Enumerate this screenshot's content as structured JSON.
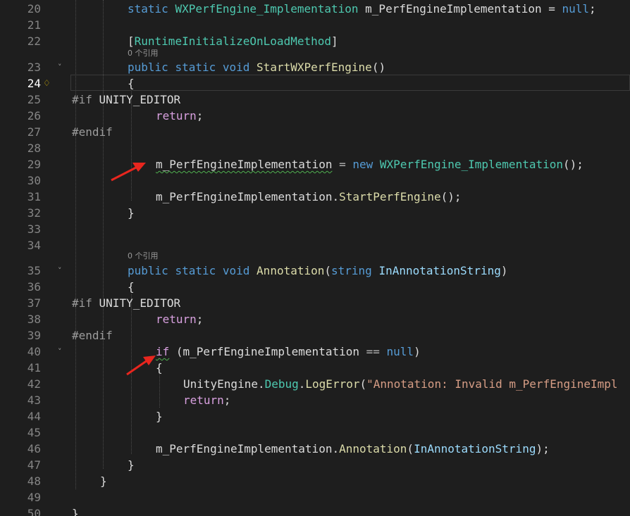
{
  "editor": {
    "active_line": "24",
    "code_lens": "0 个引用",
    "lines": [
      {
        "n": "20",
        "indent": 2,
        "tokens": [
          {
            "t": "static",
            "c": "kw"
          },
          {
            "t": " "
          },
          {
            "t": "WXPerfEngine_Implementation",
            "c": "ty"
          },
          {
            "t": " m_PerfEngineImplementation = ",
            "c": "vr"
          },
          {
            "t": "null",
            "c": "kw"
          },
          {
            "t": ";"
          }
        ]
      },
      {
        "n": "21",
        "indent": 0,
        "tokens": []
      },
      {
        "n": "22",
        "indent": 2,
        "tokens": [
          {
            "t": "[",
            "c": "pn"
          },
          {
            "t": "RuntimeInitializeOnLoadMethod",
            "c": "ty"
          },
          {
            "t": "]",
            "c": "pn"
          }
        ]
      },
      {
        "n": "23",
        "indent": 2,
        "fold": true,
        "tokens": [
          {
            "t": "public",
            "c": "kw"
          },
          {
            "t": " "
          },
          {
            "t": "static",
            "c": "kw"
          },
          {
            "t": " "
          },
          {
            "t": "void",
            "c": "kw"
          },
          {
            "t": " "
          },
          {
            "t": "StartWXPerfEngine",
            "c": "fn"
          },
          {
            "t": "()"
          }
        ]
      },
      {
        "n": "24",
        "indent": 2,
        "bulb": true,
        "tokens": [
          {
            "t": "{"
          }
        ]
      },
      {
        "n": "25",
        "indent": 0,
        "tokens": [
          {
            "t": "#if",
            "c": "pp"
          },
          {
            "t": " UNITY_EDITOR"
          }
        ]
      },
      {
        "n": "26",
        "indent": 3,
        "tokens": [
          {
            "t": "return",
            "c": "pk"
          },
          {
            "t": ";"
          }
        ]
      },
      {
        "n": "27",
        "indent": 0,
        "tokens": [
          {
            "t": "#endif",
            "c": "pp"
          }
        ]
      },
      {
        "n": "28",
        "indent": 0,
        "tokens": []
      },
      {
        "n": "29",
        "indent": 3,
        "tokens": [
          {
            "t": "m_PerfEngineImplementation",
            "c": "vr",
            "squig": true
          },
          {
            "t": " = ",
            "c": "op"
          },
          {
            "t": "new",
            "c": "kw"
          },
          {
            "t": " "
          },
          {
            "t": "WXPerfEngine_Implementation",
            "c": "ty"
          },
          {
            "t": "();"
          }
        ]
      },
      {
        "n": "30",
        "indent": 0,
        "tokens": []
      },
      {
        "n": "31",
        "indent": 3,
        "tokens": [
          {
            "t": "m_PerfEngineImplementation."
          },
          {
            "t": "StartPerfEngine",
            "c": "fn"
          },
          {
            "t": "();"
          }
        ]
      },
      {
        "n": "32",
        "indent": 2,
        "tokens": [
          {
            "t": "}"
          }
        ]
      },
      {
        "n": "33",
        "indent": 0,
        "tokens": []
      },
      {
        "n": "34",
        "indent": 0,
        "tokens": []
      },
      {
        "n": "35",
        "indent": 2,
        "fold": true,
        "tokens": [
          {
            "t": "public",
            "c": "kw"
          },
          {
            "t": " "
          },
          {
            "t": "static",
            "c": "kw"
          },
          {
            "t": " "
          },
          {
            "t": "void",
            "c": "kw"
          },
          {
            "t": " "
          },
          {
            "t": "Annotation",
            "c": "fn"
          },
          {
            "t": "("
          },
          {
            "t": "string",
            "c": "kw"
          },
          {
            "t": " "
          },
          {
            "t": "InAnnotationString",
            "c": "pa"
          },
          {
            "t": ")"
          }
        ]
      },
      {
        "n": "36",
        "indent": 2,
        "tokens": [
          {
            "t": "{"
          }
        ]
      },
      {
        "n": "37",
        "indent": 0,
        "tokens": [
          {
            "t": "#if",
            "c": "pp"
          },
          {
            "t": " UNITY_EDITOR"
          }
        ]
      },
      {
        "n": "38",
        "indent": 3,
        "tokens": [
          {
            "t": "return",
            "c": "pk"
          },
          {
            "t": ";"
          }
        ]
      },
      {
        "n": "39",
        "indent": 0,
        "tokens": [
          {
            "t": "#endif",
            "c": "pp"
          }
        ]
      },
      {
        "n": "40",
        "indent": 3,
        "fold": true,
        "tokens": [
          {
            "t": "if",
            "c": "pk",
            "squig": true
          },
          {
            "t": " (m_PerfEngineImplementation "
          },
          {
            "t": "==",
            "c": "op"
          },
          {
            "t": " "
          },
          {
            "t": "null",
            "c": "kw"
          },
          {
            "t": ")"
          }
        ]
      },
      {
        "n": "41",
        "indent": 3,
        "tokens": [
          {
            "t": "{"
          }
        ]
      },
      {
        "n": "42",
        "indent": 4,
        "tokens": [
          {
            "t": "UnityEngine."
          },
          {
            "t": "Debug",
            "c": "ty"
          },
          {
            "t": "."
          },
          {
            "t": "LogError",
            "c": "fn"
          },
          {
            "t": "("
          },
          {
            "t": "\"Annotation: Invalid m_PerfEngineImpl",
            "c": "st"
          }
        ]
      },
      {
        "n": "43",
        "indent": 4,
        "tokens": [
          {
            "t": "return",
            "c": "pk"
          },
          {
            "t": ";"
          }
        ]
      },
      {
        "n": "44",
        "indent": 3,
        "tokens": [
          {
            "t": "}"
          }
        ]
      },
      {
        "n": "45",
        "indent": 0,
        "tokens": []
      },
      {
        "n": "46",
        "indent": 3,
        "tokens": [
          {
            "t": "m_PerfEngineImplementation."
          },
          {
            "t": "Annotation",
            "c": "fn"
          },
          {
            "t": "("
          },
          {
            "t": "InAnnotationString",
            "c": "pa"
          },
          {
            "t": ");"
          }
        ]
      },
      {
        "n": "47",
        "indent": 2,
        "tokens": [
          {
            "t": "}"
          }
        ]
      },
      {
        "n": "48",
        "indent": 1,
        "tokens": [
          {
            "t": "}"
          }
        ]
      },
      {
        "n": "49",
        "indent": 0,
        "tokens": []
      },
      {
        "n": "50",
        "indent": 0,
        "tokens": [
          {
            "t": "}"
          }
        ]
      }
    ]
  },
  "colors": {
    "background": "#1e1e1e",
    "keyword": "#569cd6",
    "type": "#4ec9b0",
    "method": "#dcdcaa",
    "string": "#d69d85",
    "control_keyword": "#d8a0df",
    "preprocessor": "#9b9b9b",
    "parameter": "#9cdcfe",
    "line_number": "#858585",
    "annotation_arrow": "#e8261e"
  },
  "icons": {
    "fold": "chevron-down-icon",
    "quick_action": "lightbulb-icon",
    "annotation": "red-arrow-icon"
  }
}
